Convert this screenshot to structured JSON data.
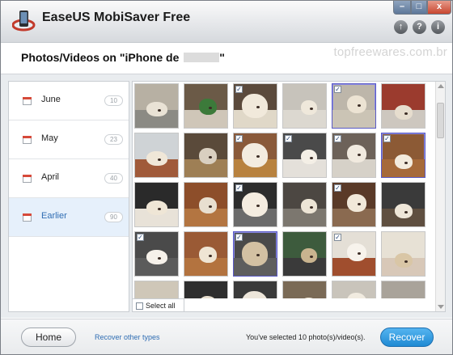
{
  "app": {
    "title": "EaseUS MobiSaver Free",
    "logo_icon": "mobisaver-logo-icon"
  },
  "window_controls": {
    "minimize": "–",
    "maximize": "□",
    "close": "x"
  },
  "toolbar": {
    "upgrade": "↑",
    "help": "?",
    "info": "i"
  },
  "header": {
    "title_prefix": "Photos/Videos on \"iPhone de",
    "title_suffix": "\"",
    "watermark": "topfreewares.com.br"
  },
  "sidebar": {
    "items": [
      {
        "label": "June",
        "count": "10",
        "active": false
      },
      {
        "label": "May",
        "count": "23",
        "active": false
      },
      {
        "label": "April",
        "count": "40",
        "active": false
      },
      {
        "label": "Earlier",
        "count": "90",
        "active": true
      }
    ]
  },
  "grid": {
    "select_all_label": "Select all",
    "thumbnails": [
      {
        "checked": false,
        "selected": false,
        "bg": "#b7b0a3",
        "floor": "#8b8a84",
        "dog": "#e9e2d5"
      },
      {
        "checked": false,
        "selected": false,
        "bg": "#6b5a47",
        "floor": "#cfc6b8",
        "dog": "#3c7a3a"
      },
      {
        "checked": true,
        "selected": false,
        "bg": "#5b4a3c",
        "floor": "#e0d8c8",
        "dog": "#f1e9db"
      },
      {
        "checked": false,
        "selected": false,
        "bg": "#c7c3bb",
        "floor": "#dcd8d0",
        "dog": "#efe8db"
      },
      {
        "checked": true,
        "selected": true,
        "bg": "#bdb6aa",
        "floor": "#cbc4b5",
        "dog": "#ece3d3"
      },
      {
        "checked": false,
        "selected": false,
        "bg": "#9b3b2e",
        "floor": "#cdc7bf",
        "dog": "#e6ddce"
      },
      {
        "checked": false,
        "selected": false,
        "bg": "#cfd3d6",
        "floor": "#a05a3a",
        "dog": "#f0e7d8"
      },
      {
        "checked": false,
        "selected": false,
        "bg": "#5a4a3a",
        "floor": "#9e7f55",
        "dog": "#d9cfc0"
      },
      {
        "checked": true,
        "selected": false,
        "bg": "#8a5a3a",
        "floor": "#b8823f",
        "dog": "#f3ece0"
      },
      {
        "checked": true,
        "selected": false,
        "bg": "#4a4a4a",
        "floor": "#e4e0da",
        "dog": "#f4efe6"
      },
      {
        "checked": true,
        "selected": false,
        "bg": "#6d6259",
        "floor": "#d6d1c8",
        "dog": "#f1eadf"
      },
      {
        "checked": true,
        "selected": true,
        "bg": "#8c5a35",
        "floor": "#a66a3a",
        "dog": "#f3ebdd"
      },
      {
        "checked": false,
        "selected": false,
        "bg": "#2a2a2a",
        "floor": "#e8e2d8",
        "dog": "#efe6d6"
      },
      {
        "checked": false,
        "selected": false,
        "bg": "#8d4e2a",
        "floor": "#b37541",
        "dog": "#e8dfd0"
      },
      {
        "checked": true,
        "selected": false,
        "bg": "#2d2d2d",
        "floor": "#6b6b6b",
        "dog": "#f4ece0"
      },
      {
        "checked": false,
        "selected": false,
        "bg": "#4c4742",
        "floor": "#7c776f",
        "dog": "#ede5d6"
      },
      {
        "checked": true,
        "selected": false,
        "bg": "#5a3a28",
        "floor": "#8a6a50",
        "dog": "#f1e8d9"
      },
      {
        "checked": false,
        "selected": false,
        "bg": "#3a3a3a",
        "floor": "#5f4f40",
        "dog": "#eee6d8"
      },
      {
        "checked": true,
        "selected": false,
        "bg": "#4a4a4a",
        "floor": "#5b5b5b",
        "dog": "#f6f1ea"
      },
      {
        "checked": false,
        "selected": false,
        "bg": "#9a5a35",
        "floor": "#b3733f",
        "dog": "#efe5d4"
      },
      {
        "checked": true,
        "selected": true,
        "bg": "#4a4a4a",
        "floor": "#5e5e5e",
        "dog": "#d3c1a3"
      },
      {
        "checked": false,
        "selected": false,
        "bg": "#3d5b3d",
        "floor": "#3a3a3a",
        "dog": "#c9b48f"
      },
      {
        "checked": true,
        "selected": false,
        "bg": "#e4dfd6",
        "floor": "#a04e2e",
        "dog": "#f7f3ec"
      },
      {
        "checked": false,
        "selected": false,
        "bg": "#e7e1d5",
        "floor": "#d8c8b8",
        "dog": "#d9c6a6"
      },
      {
        "checked": false,
        "selected": false,
        "bg": "#cfc7b8",
        "floor": "#b8ad9a",
        "dog": "#e2d5bf"
      },
      {
        "checked": false,
        "selected": false,
        "bg": "#2e2e2e",
        "floor": "#6a6a6a",
        "dog": "#e8dfcf"
      },
      {
        "checked": false,
        "selected": false,
        "bg": "#3a3a3a",
        "floor": "#d9d4cc",
        "dog": "#ede6da"
      },
      {
        "checked": false,
        "selected": false,
        "bg": "#7a6a56",
        "floor": "#a89a84",
        "dog": "#ebe2d2"
      },
      {
        "checked": false,
        "selected": false,
        "bg": "#c9c4bb",
        "floor": "#d8d3ca",
        "dog": "#f1ebe0"
      },
      {
        "checked": false,
        "selected": false,
        "bg": "#a9a39a",
        "floor": "#c8c3ba",
        "dog": "#efe9df"
      }
    ]
  },
  "footer": {
    "home_label": "Home",
    "recover_other_label": "Recover other types",
    "status_text": "You've selected 10 photo(s)/video(s).",
    "recover_label": "Recover"
  }
}
